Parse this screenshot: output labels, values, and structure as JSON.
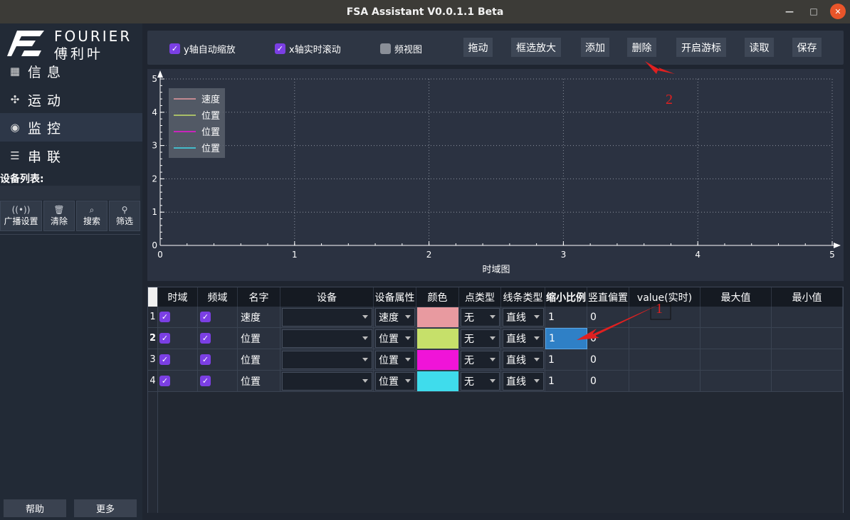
{
  "window": {
    "title": "FSA Assistant V0.0.1.1 Beta",
    "min": "—",
    "max": "□",
    "close": "✕"
  },
  "brand": {
    "en": "FOURIER",
    "cn": "傅利叶"
  },
  "nav": [
    {
      "label": "信息",
      "icon": "grid-icon"
    },
    {
      "label": "运动",
      "icon": "fan-icon"
    },
    {
      "label": "监控",
      "icon": "monitor-icon"
    },
    {
      "label": "串联",
      "icon": "sliders-icon"
    }
  ],
  "devices": {
    "label": "设备列表:",
    "tools": [
      {
        "label": "广播设置",
        "icon": "((•))"
      },
      {
        "label": "清除",
        "icon": "🗑"
      },
      {
        "label": "搜索",
        "icon": "⌕"
      },
      {
        "label": "筛选",
        "icon": "⚲"
      }
    ],
    "help": "帮助",
    "more": "更多"
  },
  "toolbar": {
    "y_auto": "y轴自动缩放",
    "x_scroll": "x轴实时滚动",
    "freq_view": "频视图",
    "buttons": [
      "拖动",
      "框选放大",
      "添加",
      "删除",
      "开启游标",
      "读取",
      "保存"
    ]
  },
  "chart_data": {
    "type": "line",
    "xlabel": "时域图",
    "xlim": [
      0,
      5
    ],
    "ylim": [
      0,
      5
    ],
    "x_ticks": [
      "0",
      "1",
      "2",
      "3",
      "4",
      "5"
    ],
    "y_ticks": [
      "0",
      "1",
      "2",
      "3",
      "4",
      "5"
    ],
    "grid": true,
    "legend_placement": "top-left",
    "series": [
      {
        "name": "速度",
        "color": "#e89aa0",
        "values": []
      },
      {
        "name": "位置",
        "color": "#c6e06a",
        "values": []
      },
      {
        "name": "位置",
        "color": "#f014d8",
        "values": []
      },
      {
        "name": "位置",
        "color": "#3fdcec",
        "values": []
      }
    ]
  },
  "table": {
    "headers": [
      "时域",
      "频域",
      "名字",
      "设备",
      "设备属性",
      "颜色",
      "点类型",
      "线条类型",
      "缩小比例",
      "竖直偏置",
      "value(实时)",
      "最大值",
      "最小值"
    ],
    "rows": [
      {
        "num": "1",
        "name": "速度",
        "device": "",
        "attr": "速度",
        "color": "#e89aa0",
        "point": "无",
        "line": "直线",
        "scale": "1",
        "offset": "0"
      },
      {
        "num": "2",
        "name": "位置",
        "device": "",
        "attr": "位置",
        "color": "#c6e06a",
        "point": "无",
        "line": "直线",
        "scale": "1",
        "offset": "0"
      },
      {
        "num": "3",
        "name": "位置",
        "device": "",
        "attr": "位置",
        "color": "#f014d8",
        "point": "无",
        "line": "直线",
        "scale": "1",
        "offset": "0"
      },
      {
        "num": "4",
        "name": "位置",
        "device": "",
        "attr": "位置",
        "color": "#3fdcec",
        "point": "无",
        "line": "直线",
        "scale": "1",
        "offset": "0"
      }
    ]
  },
  "annotations": {
    "arrow1": "1",
    "arrow2": "2",
    "color": "#e02020"
  }
}
